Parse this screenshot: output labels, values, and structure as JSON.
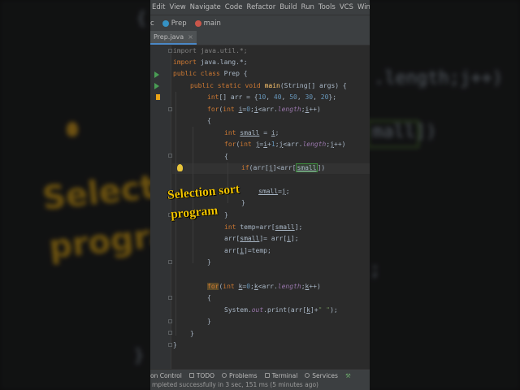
{
  "menu": [
    "Edit",
    "View",
    "Navigate",
    "Code",
    "Refactor",
    "Build",
    "Run",
    "Tools",
    "VCS",
    "Windo"
  ],
  "breadcrumb": {
    "project_tail": "c",
    "class_name": "Prep",
    "method_name": "main"
  },
  "editor_tab": {
    "file_name": "Prep.java",
    "close_glyph": "×"
  },
  "code": {
    "l1": [
      "import java.util.*;"
    ],
    "l2": [
      "import",
      " java.lang.*;"
    ],
    "l3": [
      "public",
      " ",
      "class",
      " Prep {"
    ],
    "l4": [
      "public",
      " ",
      "static",
      " ",
      "void",
      " ",
      "main",
      "(String[] args) {"
    ],
    "l5": [
      "int",
      "[] arr = {",
      "10",
      ", ",
      "40",
      ", ",
      "50",
      ", ",
      "30",
      ", ",
      "20",
      "};"
    ],
    "l6": [
      "for",
      "(",
      "int",
      " ",
      "i",
      "=",
      "0",
      ";",
      "i",
      "<arr.",
      "length",
      ";",
      "i",
      "++)"
    ],
    "l7": [
      "{"
    ],
    "l8": [
      "int",
      " ",
      "small",
      " = ",
      "i",
      ";"
    ],
    "l9": [
      "for",
      "(",
      "int",
      " ",
      "j",
      "=",
      "i",
      "+",
      "1",
      ";",
      "j",
      "<arr.",
      "length",
      ";",
      "j",
      "++)"
    ],
    "l10": [
      "{"
    ],
    "l11": [
      "if",
      "(arr[",
      "j",
      "]<arr[",
      "small",
      "])"
    ],
    "l12": [
      "small",
      "=",
      "j",
      ";"
    ],
    "l13": [
      "}"
    ],
    "l14": [
      "}"
    ],
    "l15": [
      "int",
      " temp=arr[",
      "small",
      "];"
    ],
    "l16": [
      "arr[",
      "small",
      "]= arr[",
      "i",
      "];"
    ],
    "l17": [
      "arr[",
      "i",
      "]=temp;"
    ],
    "l18": [
      "}"
    ],
    "l19": [
      "for",
      "(",
      "int",
      " ",
      "k",
      "=",
      "0",
      ";",
      "k",
      "<arr.",
      "length",
      ";",
      "k",
      "++)"
    ],
    "l20": [
      "{"
    ],
    "l21": [
      "System.",
      "out",
      ".print(arr[",
      "k",
      "]+",
      "\" \"",
      ");"
    ],
    "l22": [
      "}"
    ],
    "l23": [
      "}"
    ],
    "l24": [
      "}"
    ]
  },
  "overlay": {
    "line1": "Selection sort",
    "line2": "program"
  },
  "background": {
    "title_line1": "Selectio",
    "title_line2": "progra",
    "code_top": ".length;j++)",
    "code_mid": "mall])",
    "code_bottom": ";",
    "brace_left": "{",
    "brace_left_bottom": "}"
  },
  "tool_windows": [
    "on Control",
    "TODO",
    "Problems",
    "Terminal",
    "Services"
  ],
  "status_message": "mpleted successfully in 3 sec, 151 ms (5 minutes ago)",
  "colors": {
    "keyword": "#cc7832",
    "number": "#6897bb",
    "method": "#ffc66d",
    "string": "#6a8759",
    "field": "#9876aa",
    "overlay_text": "#f2c400",
    "editor_bg": "#2b2b2b"
  }
}
